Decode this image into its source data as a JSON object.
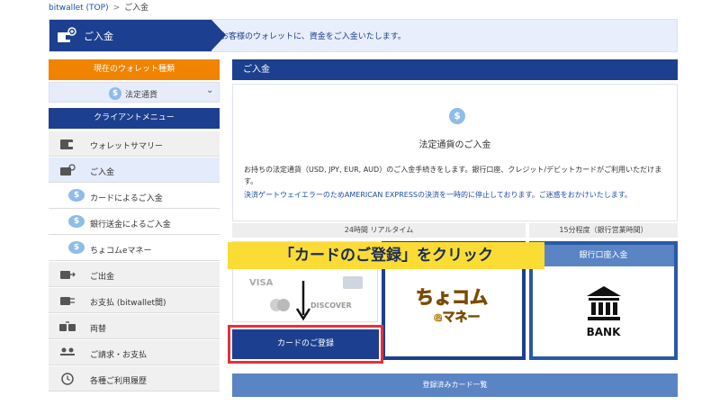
{
  "breadcrumb": {
    "home": "bitwallet (TOP)",
    "separator": ">",
    "current": "ご入金"
  },
  "banner": {
    "title": "ご入金",
    "description": "お客様のウォレットに、資金をご入金いたします。"
  },
  "sidebar": {
    "current_wallet_label": "現在のウォレット種類",
    "currency_value": "法定通貨",
    "client_menu_label": "クライアントメニュー",
    "items": [
      {
        "label": "ウォレットサマリー",
        "icon": "wallet-icon"
      },
      {
        "label": "ご入金",
        "icon": "deposit-icon"
      },
      {
        "label": "カードによるご入金",
        "icon": "coin-icon"
      },
      {
        "label": "銀行送金によるご入金",
        "icon": "coin-icon"
      },
      {
        "label": "ちょコムeマネー",
        "icon": "coin-icon"
      },
      {
        "label": "ご出金",
        "icon": "withdraw-icon"
      },
      {
        "label": "お支払 (bitwallet間)",
        "icon": "payment-icon"
      },
      {
        "label": "両替",
        "icon": "exchange-icon"
      },
      {
        "label": "ご請求・お支払",
        "icon": "users-icon"
      },
      {
        "label": "各種ご利用履歴",
        "icon": "history-icon"
      }
    ]
  },
  "main": {
    "header": "ご入金",
    "title": "法定通貨のご入金",
    "description": "お持ちの法定通貨（USD, JPY, EUR, AUD）のご入金手続きをします。銀行口座、クレジット/デビットカードがご利用いただけます。",
    "warning": "決済ゲートウェイエラーのためAMERICAN EXPRESSの決済を一時的に停止しております。ご迷惑をおかけいたします。",
    "timing_realtime": "24時間 リアルタイム",
    "timing_bank": "15分程度（銀行営業時間）",
    "bank_header": "銀行口座入金",
    "bank_text": "BANK",
    "card_brands": {
      "visa": "VISA",
      "discover": "DISCOVER",
      "choco_top": "ちょコム",
      "choco_bottom": "eマネー"
    },
    "register_button": "カードのご登録",
    "registered_cards": "登録済みカード一覧"
  },
  "callout": "「カードのご登録」をクリック",
  "colors": {
    "navy": "#1d3f8f",
    "orange": "#f08300",
    "highlight": "#fbdc34",
    "outline": "#e8303a"
  }
}
